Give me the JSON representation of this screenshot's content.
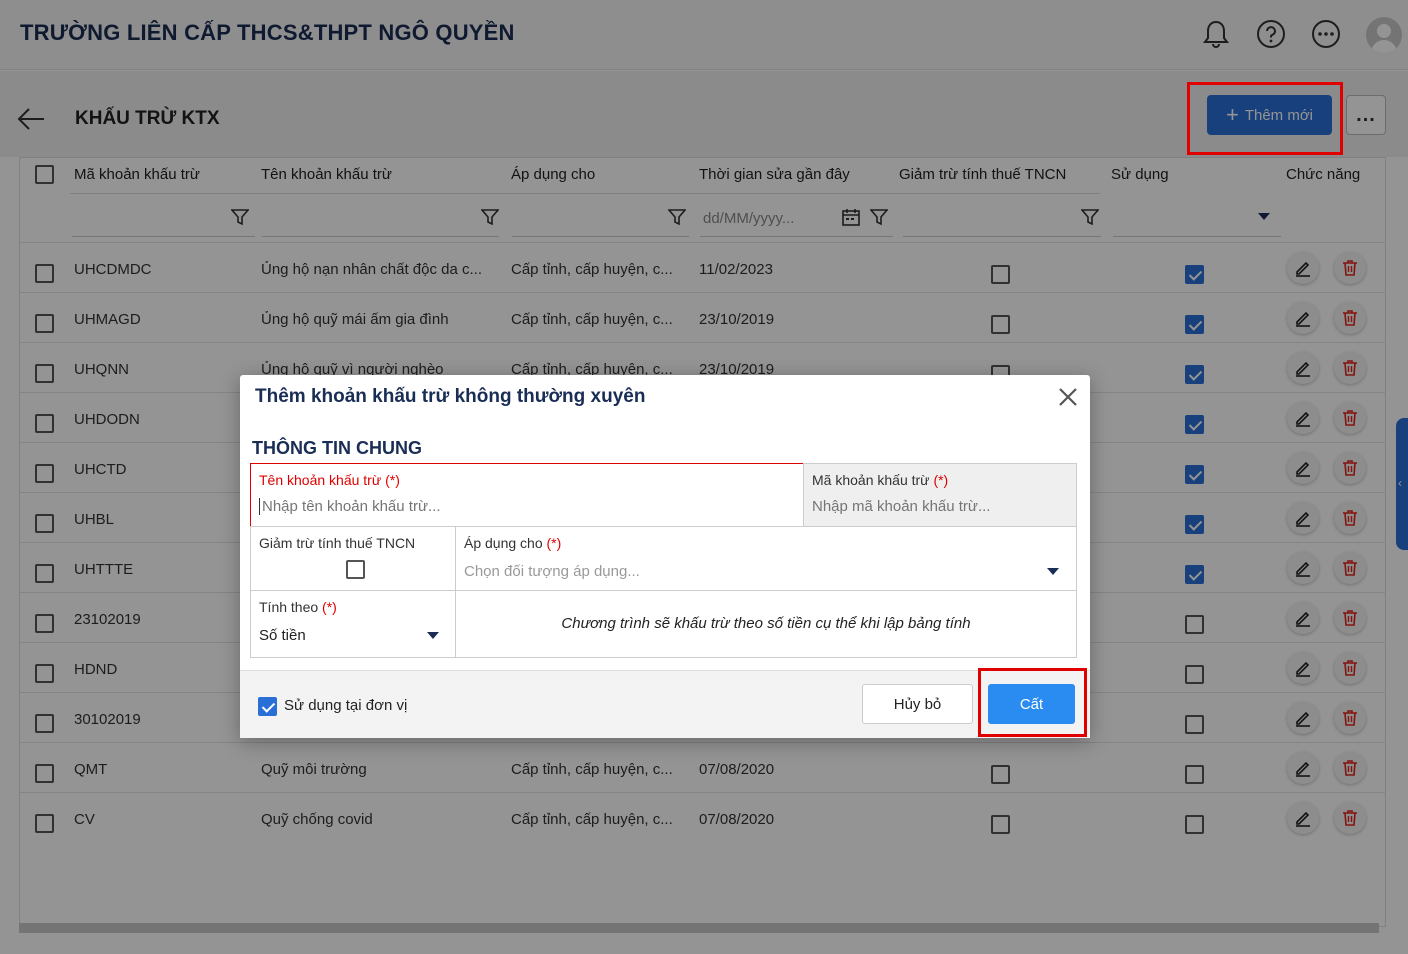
{
  "header": {
    "school_name": "TRƯỜNG LIÊN CẤP THCS&THPT NGÔ QUYỀN"
  },
  "page": {
    "title": "KHẤU TRỪ KTX",
    "add_label": "Thêm mới",
    "more_label": "..."
  },
  "table": {
    "columns": [
      "Mã khoản khấu trừ",
      "Tên khoản khấu trừ",
      "Áp dụng cho",
      "Thời gian sửa gần đây",
      "Giảm trừ tính thuế TNCN",
      "Sử dụng",
      "Chức năng"
    ],
    "date_filter_placeholder": "dd/MM/yyyy...",
    "rows": [
      {
        "code": "UHCDMDC",
        "name": "Ủng hộ nạn nhân chất độc da c...",
        "apply": "Cấp tỉnh, cấp huyện, c...",
        "date": "11/02/2023",
        "tax": false,
        "use": true
      },
      {
        "code": "UHMAGD",
        "name": "Ủng hộ quỹ mái ấm gia đình",
        "apply": "Cấp tỉnh, cấp huyện, c...",
        "date": "23/10/2019",
        "tax": false,
        "use": true
      },
      {
        "code": "UHQNN",
        "name": "Ủng hộ quỹ vì người nghèo",
        "apply": "Cấp tỉnh, cấp huyện, c...",
        "date": "23/10/2019",
        "tax": false,
        "use": true
      },
      {
        "code": "UHDODN",
        "name": "",
        "apply": "",
        "date": "",
        "tax": false,
        "use": true
      },
      {
        "code": "UHCTD",
        "name": "",
        "apply": "",
        "date": "",
        "tax": false,
        "use": true
      },
      {
        "code": "UHBL",
        "name": "",
        "apply": "",
        "date": "",
        "tax": false,
        "use": true
      },
      {
        "code": "UHTTTE",
        "name": "",
        "apply": "",
        "date": "",
        "tax": false,
        "use": true
      },
      {
        "code": "23102019",
        "name": "",
        "apply": "",
        "date": "",
        "tax": false,
        "use": false
      },
      {
        "code": "HDND",
        "name": "",
        "apply": "",
        "date": "",
        "tax": false,
        "use": false
      },
      {
        "code": "30102019",
        "name": "",
        "apply": "",
        "date": "",
        "tax": false,
        "use": false
      },
      {
        "code": "QMT",
        "name": "Quỹ môi trường",
        "apply": "Cấp tỉnh, cấp huyện, c...",
        "date": "07/08/2020",
        "tax": false,
        "use": false
      },
      {
        "code": "CV",
        "name": "Quỹ chống covid",
        "apply": "Cấp tỉnh, cấp huyện, c...",
        "date": "07/08/2020",
        "tax": false,
        "use": false
      }
    ]
  },
  "modal": {
    "title": "Thêm khoản khấu trừ không thường xuyên",
    "section": "THÔNG TIN CHUNG",
    "name_label": "Tên khoản khấu trừ",
    "name_placeholder": "Nhập tên khoản khấu trừ...",
    "code_label": "Mã khoản khấu trừ",
    "code_placeholder": "Nhập mã khoản khấu trừ...",
    "tax_label": "Giảm trừ tính thuế TNCN",
    "apply_label": "Áp dụng cho",
    "apply_placeholder": "Chọn đối tượng áp dụng...",
    "calc_label": "Tính theo",
    "calc_value": "Số tiền",
    "note": "Chương trình sẽ khấu trừ theo số tiền cụ thể khi lập bảng tính",
    "required_mark": "(*)",
    "use_label": "Sử dụng tại đơn vị",
    "use_checked": true,
    "cancel_label": "Hủy bỏ",
    "save_label": "Cất"
  },
  "colors": {
    "primary": "#2a6fd6",
    "save": "#2a8cf0",
    "highlight": "#e00000",
    "title": "#1a2d55"
  }
}
